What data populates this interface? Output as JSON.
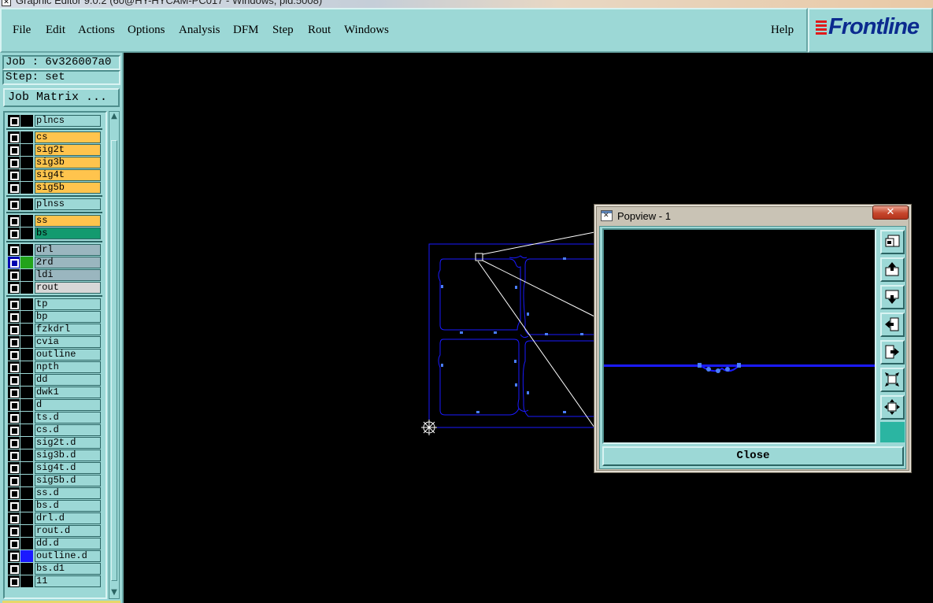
{
  "window": {
    "title": "Graphic Editor 9.0.2 (60@HY-HYCAM-PC017 - Windows, pid:5008)",
    "icon": "app-icon"
  },
  "menu": {
    "items": [
      "File",
      "Edit",
      "Actions",
      "Options",
      "Analysis",
      "DFM",
      "Step",
      "Rout",
      "Windows"
    ],
    "help": "Help"
  },
  "logo": {
    "text": "Frontline",
    "color": "#0b2a8f",
    "accent": "#e01b1b"
  },
  "job": {
    "label": "Job : 6v326007a0",
    "step": "Step: set",
    "matrix_button": "Job Matrix ..."
  },
  "layers": [
    {
      "name": "plncs",
      "style": "plain"
    },
    {
      "name": "cs",
      "style": "orange"
    },
    {
      "name": "sig2t",
      "style": "orange"
    },
    {
      "name": "sig3b",
      "style": "orange"
    },
    {
      "name": "sig4t",
      "style": "orange"
    },
    {
      "name": "sig5b",
      "style": "orange"
    },
    {
      "name": "plnss",
      "style": "plain"
    },
    {
      "name": "ss",
      "style": "orange"
    },
    {
      "name": "bs",
      "style": "green"
    },
    {
      "name": "drl",
      "style": "grey"
    },
    {
      "name": "2rd",
      "style": "grey",
      "selected": true,
      "color": "#22a31a"
    },
    {
      "name": "ldi",
      "style": "grey"
    },
    {
      "name": "rout",
      "style": "light"
    },
    {
      "name": "tp",
      "style": "plain"
    },
    {
      "name": "bp",
      "style": "plain"
    },
    {
      "name": "fzkdrl",
      "style": "plain"
    },
    {
      "name": "cvia",
      "style": "plain"
    },
    {
      "name": "outline",
      "style": "plain"
    },
    {
      "name": "npth",
      "style": "plain"
    },
    {
      "name": "dd",
      "style": "plain"
    },
    {
      "name": "dwk1",
      "style": "plain"
    },
    {
      "name": "d",
      "style": "plain"
    },
    {
      "name": "ts.d",
      "style": "plain"
    },
    {
      "name": "cs.d",
      "style": "plain"
    },
    {
      "name": "sig2t.d",
      "style": "plain"
    },
    {
      "name": "sig3b.d",
      "style": "plain"
    },
    {
      "name": "sig4t.d",
      "style": "plain"
    },
    {
      "name": "sig5b.d",
      "style": "plain"
    },
    {
      "name": "ss.d",
      "style": "plain"
    },
    {
      "name": "bs.d",
      "style": "plain"
    },
    {
      "name": "drl.d",
      "style": "plain"
    },
    {
      "name": "rout.d",
      "style": "plain"
    },
    {
      "name": "dd.d",
      "style": "plain"
    },
    {
      "name": "outline.d",
      "style": "plain",
      "color": "#1a1aff"
    },
    {
      "name": "bs.d1",
      "style": "plain"
    },
    {
      "name": "11",
      "style": "plain"
    }
  ],
  "popview": {
    "title": "Popview - 1",
    "close_x": "✕",
    "close_button": "Close",
    "tools": [
      "zoom-fit-icon",
      "pan-up-icon",
      "pan-down-icon",
      "pan-left-icon",
      "pan-right-icon",
      "zoom-in-icon",
      "zoom-out-icon"
    ]
  },
  "colors": {
    "panel": "#9cd8d6",
    "canvas": "#000000",
    "drawing": "#1a1aff"
  }
}
